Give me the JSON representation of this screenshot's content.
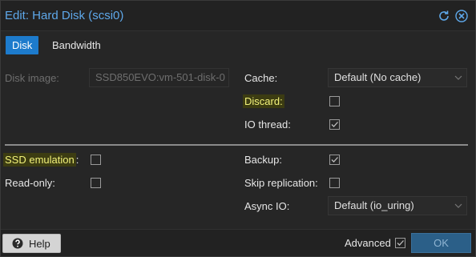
{
  "window": {
    "title": "Edit: Hard Disk (scsi0)"
  },
  "tabs": [
    {
      "label": "Disk",
      "active": true
    },
    {
      "label": "Bandwidth",
      "active": false
    }
  ],
  "form": {
    "disk_image": {
      "label": "Disk image:",
      "value": "SSD850EVO:vm-501-disk-0",
      "disabled": true
    },
    "cache": {
      "label": "Cache:",
      "value": "Default (No cache)"
    },
    "discard": {
      "label": "Discard:",
      "checked": false,
      "highlighted": true
    },
    "io_thread": {
      "label": "IO thread:",
      "checked": true
    },
    "ssd_emulation": {
      "label": "SSD emulation",
      "colon": ":",
      "checked": false,
      "highlighted": true
    },
    "read_only": {
      "label": "Read-only:",
      "checked": false
    },
    "backup": {
      "label": "Backup:",
      "checked": true
    },
    "skip_replication": {
      "label": "Skip replication:",
      "checked": false
    },
    "async_io": {
      "label": "Async IO:",
      "value": "Default (io_uring)"
    }
  },
  "footer": {
    "help_label": "Help",
    "advanced_label": "Advanced",
    "advanced_checked": true,
    "ok_label": "OK"
  },
  "colors": {
    "accent": "#1d7bcc",
    "title": "#5ea8ea",
    "highlight_bg": "#3c3c12",
    "highlight_text": "#f2f27a"
  }
}
